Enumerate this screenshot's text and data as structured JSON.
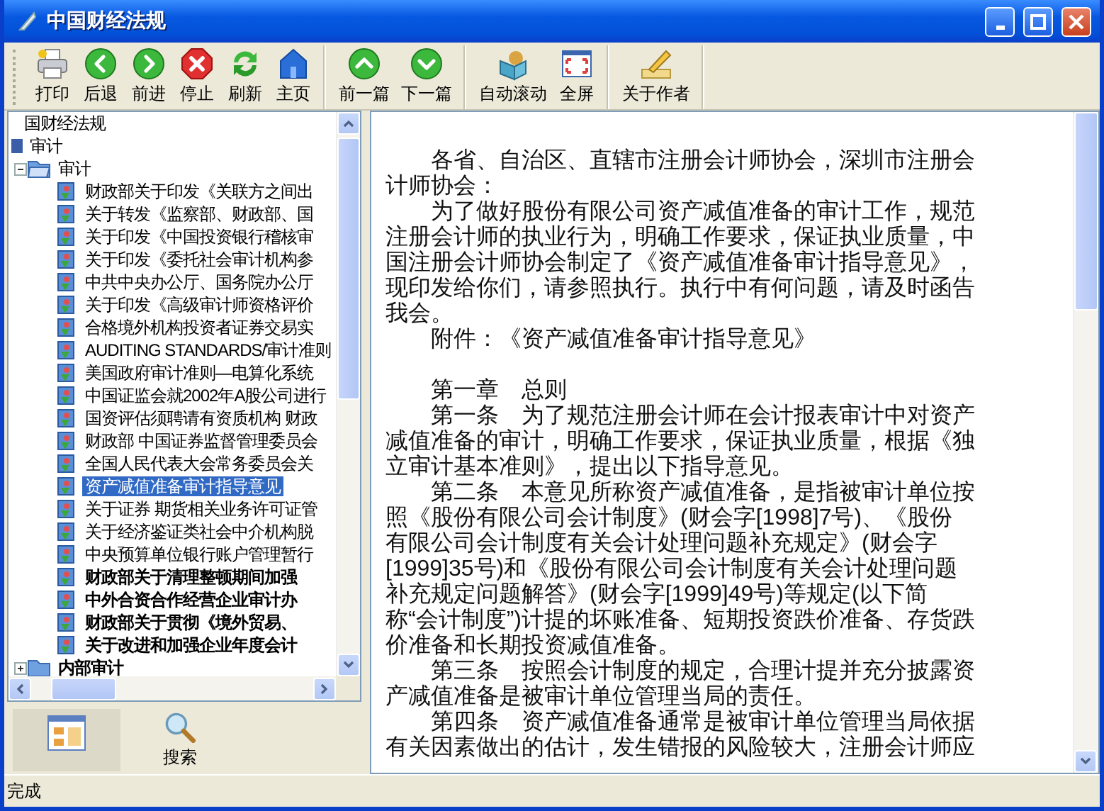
{
  "window": {
    "title": "中国财经法规"
  },
  "toolbar": [
    [
      {
        "label": "打印"
      },
      {
        "label": "后退"
      },
      {
        "label": "前进"
      },
      {
        "label": "停止"
      },
      {
        "label": "刷新"
      },
      {
        "label": "主页"
      }
    ],
    [
      {
        "label": "前一篇"
      },
      {
        "label": "下一篇"
      }
    ],
    [
      {
        "label": "自动滚动"
      },
      {
        "label": "全屏"
      }
    ],
    [
      {
        "label": "关于作者"
      }
    ]
  ],
  "tree": [
    {
      "label": "国财经法规",
      "kind": "root",
      "children": [
        {
          "label": "审计",
          "kind": "book",
          "children": [
            {
              "label": "审计",
              "kind": "folder",
              "expanded": true,
              "children": [
                {
                  "label": "财政部关于印发《关联方之间出",
                  "kind": "leaf",
                  "bold": false,
                  "selected": false
                },
                {
                  "label": "关于转发《监察部、财政部、国",
                  "kind": "leaf",
                  "bold": false,
                  "selected": false
                },
                {
                  "label": "关于印发《中国投资银行稽核审",
                  "kind": "leaf",
                  "bold": false,
                  "selected": false
                },
                {
                  "label": "关于印发《委托社会审计机构参",
                  "kind": "leaf",
                  "bold": false,
                  "selected": false
                },
                {
                  "label": "中共中央办公厅、国务院办公厅",
                  "kind": "leaf",
                  "bold": false,
                  "selected": false
                },
                {
                  "label": "关于印发《高级审计师资格评价",
                  "kind": "leaf",
                  "bold": false,
                  "selected": false
                },
                {
                  "label": "合格境外机构投资者证券交易实",
                  "kind": "leaf",
                  "bold": false,
                  "selected": false
                },
                {
                  "label": "AUDITING STANDARDS/审计准则",
                  "kind": "leaf",
                  "bold": false,
                  "selected": false
                },
                {
                  "label": "美国政府审计准则—电算化系统",
                  "kind": "leaf",
                  "bold": false,
                  "selected": false
                },
                {
                  "label": "中国证监会就2002年A股公司进行",
                  "kind": "leaf",
                  "bold": false,
                  "selected": false
                },
                {
                  "label": "国资评估须聘请有资质机构 财政",
                  "kind": "leaf",
                  "bold": false,
                  "selected": false
                },
                {
                  "label": "财政部 中国证券监督管理委员会",
                  "kind": "leaf",
                  "bold": false,
                  "selected": false
                },
                {
                  "label": "全国人民代表大会常务委员会关",
                  "kind": "leaf",
                  "bold": false,
                  "selected": false
                },
                {
                  "label": "资产减值准备审计指导意见",
                  "kind": "leaf",
                  "bold": false,
                  "selected": true
                },
                {
                  "label": "关于证券 期货相关业务许可证管",
                  "kind": "leaf",
                  "bold": false,
                  "selected": false
                },
                {
                  "label": "关于经济鉴证类社会中介机构脱",
                  "kind": "leaf",
                  "bold": false,
                  "selected": false
                },
                {
                  "label": "中央预算单位银行账户管理暂行",
                  "kind": "leaf",
                  "bold": false,
                  "selected": false
                },
                {
                  "label": "财政部关于清理整顿期间加强",
                  "kind": "leaf",
                  "bold": true,
                  "selected": false
                },
                {
                  "label": "中外合资合作经营企业审计办",
                  "kind": "leaf",
                  "bold": true,
                  "selected": false
                },
                {
                  "label": "财政部关于贯彻《境外贸易、",
                  "kind": "leaf",
                  "bold": true,
                  "selected": false
                },
                {
                  "label": "关于改进和加强企业年度会计",
                  "kind": "leaf",
                  "bold": true,
                  "selected": false
                }
              ]
            },
            {
              "label": "内部审计",
              "kind": "folder",
              "expanded": false,
              "bold": true
            }
          ]
        }
      ]
    }
  ],
  "panel_tabs": [
    {
      "selected": true
    },
    {
      "label": "搜索",
      "selected": false
    }
  ],
  "document": {
    "paragraphs": [
      "各省、自治区、直辖市注册会计师协会，深圳市注册会计师协会：",
      "为了做好股份有限公司资产减值准备的审计工作，规范注册会计师的执业行为，明确工作要求，保证执业质量，中国注册会计师协会制定了《资产减值准备审计指导意见》，现印发给你们，请参照执行。执行中有何问题，请及时函告我会。",
      "附件：《资产减值准备审计指导意见》",
      "第一章　总则",
      "第一条　为了规范注册会计师在会计报表审计中对资产减值准备的审计，明确工作要求，保证执业质量，根据《独立审计基本准则》，提出以下指导意见。",
      "第二条　本意见所称资产减值准备，是指被审计单位按照《股份有限公司会计制度》(财会字[1998]7号)、《股份有限公司会计制度有关会计处理问题补充规定》(财会字[1999]35号)和《股份有限公司会计制度有关会计处理问题补充规定问题解答》(财会字[1999]49号)等规定(以下简称“会计制度”)计提的坏账准备、短期投资跌价准备、存货跌价准备和长期投资减值准备。",
      "第三条　按照会计制度的规定，合理计提并充分披露资产减值准备是被审计单位管理当局的责任。",
      "第四条　资产减值准备通常是被审计单位管理当局依据有关因素做出的估计，发生错报的风险较大，注册会计师应"
    ]
  },
  "status_bar": {
    "text": "完成"
  }
}
